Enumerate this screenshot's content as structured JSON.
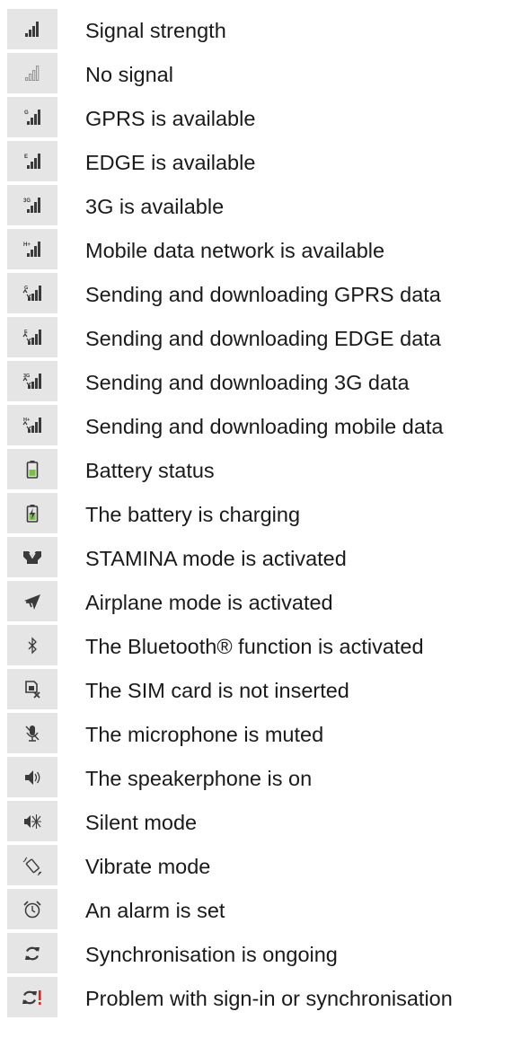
{
  "icon_legend": {
    "rows": [
      {
        "icon": "signal-strength-icon",
        "label": "Signal strength"
      },
      {
        "icon": "no-signal-icon",
        "label": "No signal"
      },
      {
        "icon": "gprs-icon",
        "label": "GPRS is available"
      },
      {
        "icon": "edge-icon",
        "label": "EDGE is available"
      },
      {
        "icon": "3g-icon",
        "label": "3G is available"
      },
      {
        "icon": "h-plus-icon",
        "label": "Mobile data network is available"
      },
      {
        "icon": "gprs-data-transfer-icon",
        "label": "Sending and downloading GPRS data"
      },
      {
        "icon": "edge-data-transfer-icon",
        "label": "Sending and downloading EDGE data"
      },
      {
        "icon": "3g-data-transfer-icon",
        "label": "Sending and downloading 3G data"
      },
      {
        "icon": "mobile-data-transfer-icon",
        "label": "Sending and downloading mobile data"
      },
      {
        "icon": "battery-icon",
        "label": "Battery status"
      },
      {
        "icon": "battery-charging-icon",
        "label": "The battery is charging"
      },
      {
        "icon": "stamina-icon",
        "label": "STAMINA mode is activated"
      },
      {
        "icon": "airplane-icon",
        "label": "Airplane mode is activated"
      },
      {
        "icon": "bluetooth-icon",
        "label": "The Bluetooth® function is activated"
      },
      {
        "icon": "no-sim-icon",
        "label": "The SIM card is not inserted"
      },
      {
        "icon": "mic-muted-icon",
        "label": "The microphone is muted"
      },
      {
        "icon": "speakerphone-icon",
        "label": "The speakerphone is on"
      },
      {
        "icon": "silent-mode-icon",
        "label": "Silent mode"
      },
      {
        "icon": "vibrate-icon",
        "label": "Vibrate mode"
      },
      {
        "icon": "alarm-icon",
        "label": "An alarm is set"
      },
      {
        "icon": "sync-icon",
        "label": "Synchronisation is ongoing"
      },
      {
        "icon": "sync-problem-icon",
        "label": "Problem with sign-in or synchronisation"
      }
    ]
  },
  "colors": {
    "icon_cell_bg": "#e5e5e5",
    "icon_dark": "#3a3a3a",
    "icon_outline": "#8a8a8a",
    "battery_green": "#7bc043",
    "warning_red": "#e0261b",
    "text": "#1a1a1a"
  }
}
